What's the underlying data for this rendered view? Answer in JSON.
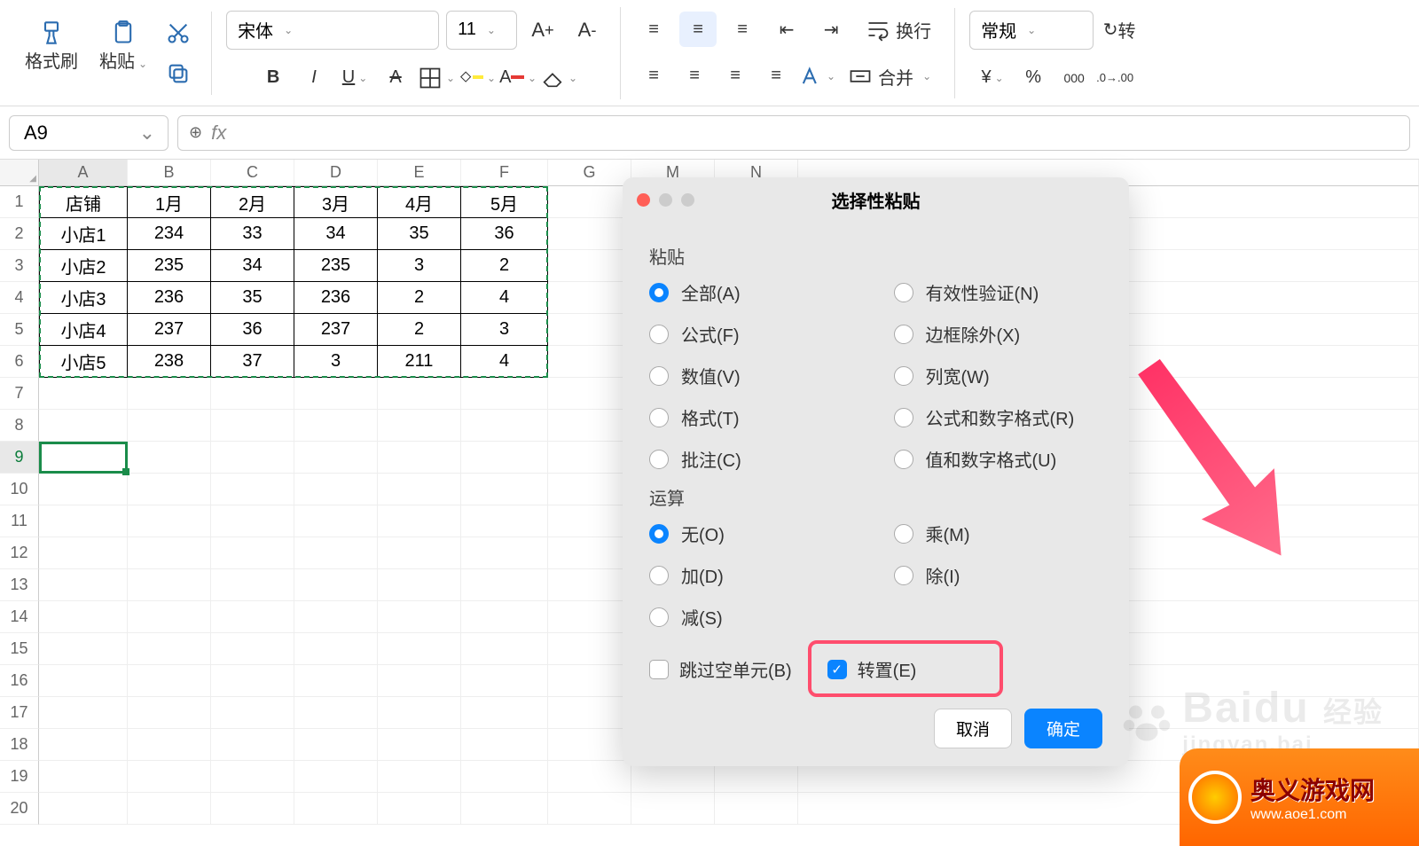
{
  "ribbon": {
    "format_painter": "格式刷",
    "paste": "粘贴",
    "font_name": "宋体",
    "font_size": "11",
    "wrap_text": "换行",
    "merge": "合并",
    "number_format": "常规",
    "rotate_label": "转"
  },
  "name_box": {
    "cell": "A9",
    "fx": "fx"
  },
  "columns": [
    "A",
    "B",
    "C",
    "D",
    "E",
    "F",
    "G",
    "M",
    "N"
  ],
  "rows": [
    "1",
    "2",
    "3",
    "4",
    "5",
    "6",
    "7",
    "8",
    "9",
    "10",
    "11",
    "12",
    "13",
    "14",
    "15",
    "16",
    "17",
    "18",
    "19",
    "20"
  ],
  "table": {
    "header": [
      "店铺",
      "1月",
      "2月",
      "3月",
      "4月",
      "5月"
    ],
    "rows": [
      [
        "小店1",
        "234",
        "33",
        "34",
        "35",
        "36"
      ],
      [
        "小店2",
        "235",
        "34",
        "235",
        "3",
        "2"
      ],
      [
        "小店3",
        "236",
        "35",
        "236",
        "2",
        "4"
      ],
      [
        "小店4",
        "237",
        "36",
        "237",
        "2",
        "3"
      ],
      [
        "小店5",
        "238",
        "37",
        "3",
        "211",
        "4"
      ]
    ]
  },
  "dialog": {
    "title": "选择性粘贴",
    "paste_section": "粘贴",
    "paste_options_left": [
      "全部(A)",
      "公式(F)",
      "数值(V)",
      "格式(T)",
      "批注(C)"
    ],
    "paste_options_right": [
      "有效性验证(N)",
      "边框除外(X)",
      "列宽(W)",
      "公式和数字格式(R)",
      "值和数字格式(U)"
    ],
    "operation_section": "运算",
    "op_left": [
      "无(O)",
      "加(D)",
      "减(S)"
    ],
    "op_right": [
      "乘(M)",
      "除(I)"
    ],
    "skip_blanks": "跳过空单元(B)",
    "transpose": "转置(E)",
    "cancel": "取消",
    "ok": "确定"
  },
  "watermark": {
    "brand": "Baidu",
    "sub": "经验",
    "line2": "jingyan.bai"
  },
  "site_badge": {
    "name": "奥义游戏网",
    "url": "www.aoe1.com"
  }
}
